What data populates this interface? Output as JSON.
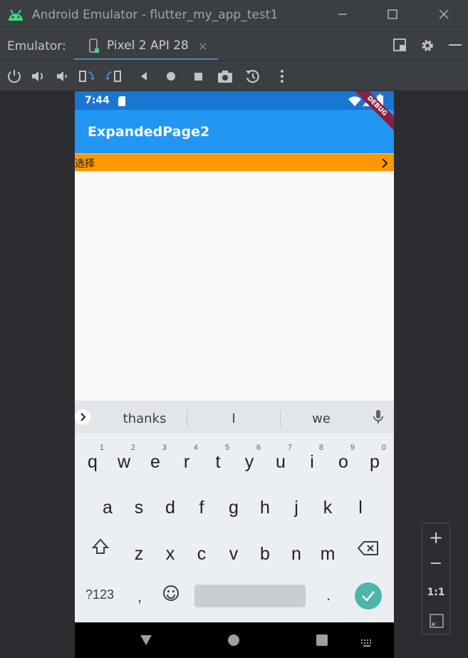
{
  "window": {
    "title": "Android Emulator - flutter_my_app_test1"
  },
  "tabbar": {
    "label": "Emulator:",
    "tab_label": "Pixel 2 API 28"
  },
  "toolbar": {
    "icons": [
      "power-icon",
      "volume-up-icon",
      "volume-down-icon",
      "rotate-left-icon",
      "rotate-right-icon",
      "back-icon",
      "home-icon",
      "overview-icon",
      "camera-icon",
      "snapshot-icon",
      "more-icon"
    ]
  },
  "device": {
    "status_time": "7:44",
    "app_title": "ExpandedPage2",
    "debug_banner": "DEBUG",
    "select_label": "选择",
    "colors": {
      "status_bar": "#1976d2",
      "app_bar": "#2196f3",
      "select_row": "#ff9800",
      "enter_key": "#4db6ac"
    }
  },
  "keyboard": {
    "suggestions": [
      "thanks",
      "I",
      "we"
    ],
    "row1": [
      {
        "ch": "q",
        "hint": "1"
      },
      {
        "ch": "w",
        "hint": "2"
      },
      {
        "ch": "e",
        "hint": "3"
      },
      {
        "ch": "r",
        "hint": "4"
      },
      {
        "ch": "t",
        "hint": "5"
      },
      {
        "ch": "y",
        "hint": "6"
      },
      {
        "ch": "u",
        "hint": "7"
      },
      {
        "ch": "i",
        "hint": "8"
      },
      {
        "ch": "o",
        "hint": "9"
      },
      {
        "ch": "p",
        "hint": "0"
      }
    ],
    "row2": [
      "a",
      "s",
      "d",
      "f",
      "g",
      "h",
      "j",
      "k",
      "l"
    ],
    "row3": [
      "z",
      "x",
      "c",
      "v",
      "b",
      "n",
      "m"
    ],
    "symbols_key": "?123",
    "comma_key": ",",
    "period_key": "."
  },
  "zoom": {
    "zoom_in": "+",
    "zoom_out": "−",
    "actual_size": "1:1"
  }
}
